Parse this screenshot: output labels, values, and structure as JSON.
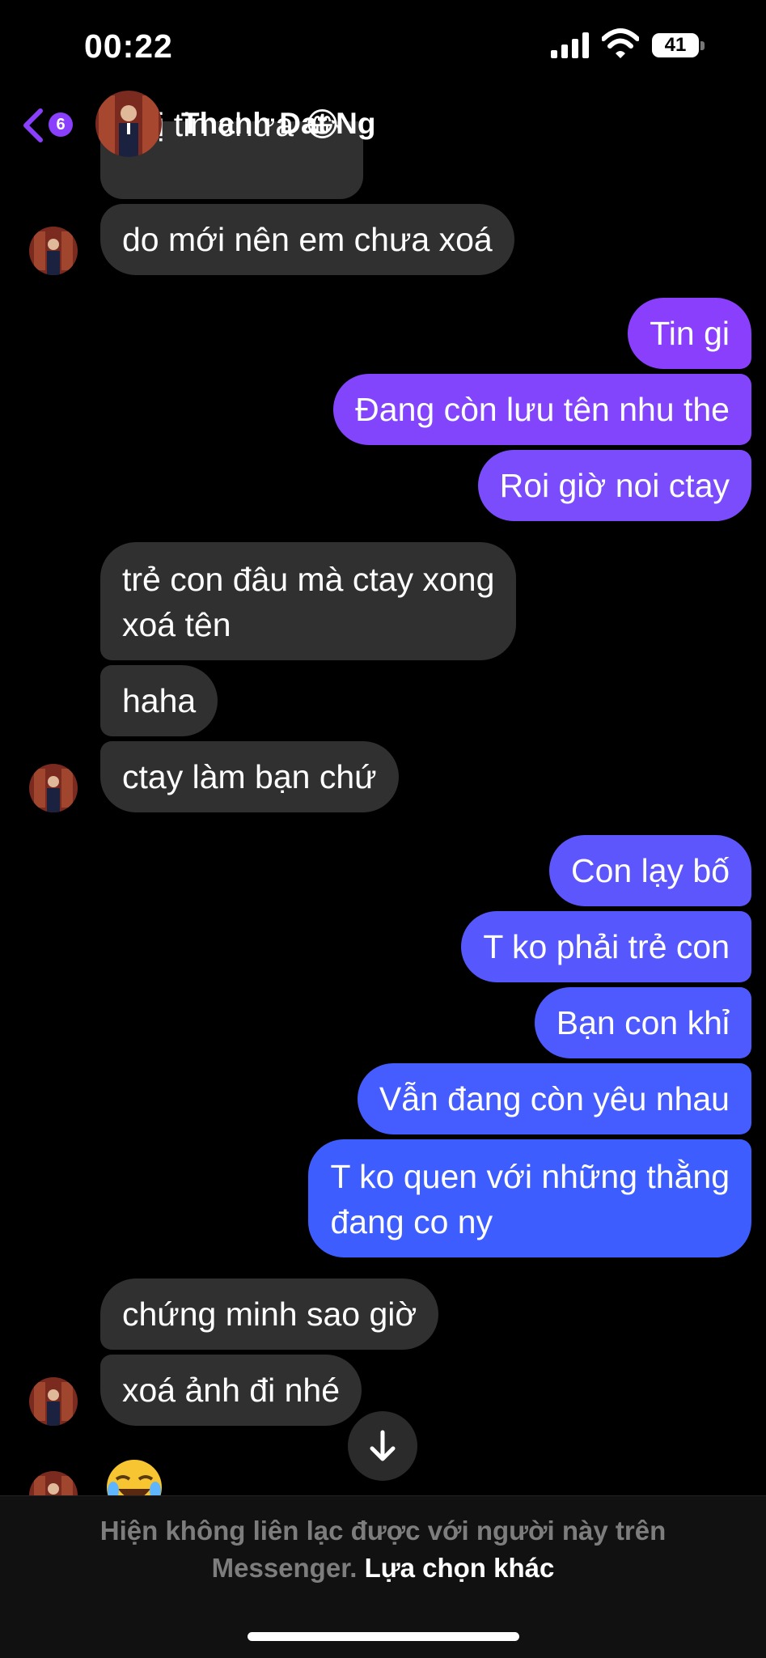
{
  "status_bar": {
    "time": "00:22",
    "battery": "41"
  },
  "header": {
    "back_badge": "6",
    "contact_name": "Thanh Dat Ng"
  },
  "messages": [
    {
      "text": "chị tin chưa 😂"
    },
    {
      "text": "do mới nên em chưa xoá"
    },
    {
      "text": "Tin gi"
    },
    {
      "text": "Đang còn lưu tên nhu the"
    },
    {
      "text": "Roi giờ noi ctay"
    },
    {
      "text": "trẻ con đâu mà ctay xong"
    },
    {
      "text": "xoá tên"
    },
    {
      "text": "haha"
    },
    {
      "text": "ctay làm bạn chứ"
    },
    {
      "text": "Con lạy bố"
    },
    {
      "text": "T ko phải trẻ con"
    },
    {
      "text": "Bạn con khỉ"
    },
    {
      "text": "Vẫn đang còn yêu nhau"
    },
    {
      "text": "T ko quen với những thằng"
    },
    {
      "text": "đang co ny"
    },
    {
      "text": "chứng minh sao giờ"
    },
    {
      "text": "xoá ảnh đi nhé"
    }
  ],
  "footer": {
    "notice_line1": "Hiện không liên lạc được với người này trên",
    "notice_line2": "Messenger.",
    "link": "Lựa chọn khác"
  },
  "colors": {
    "incoming_bubble": "#303030",
    "outgoing_top": "#8a3ffc",
    "outgoing_bottom": "#3b5bff",
    "badge": "#8a3ffc"
  }
}
